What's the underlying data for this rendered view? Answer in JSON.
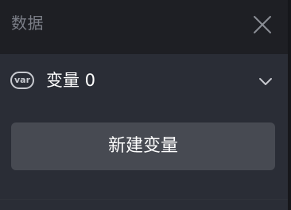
{
  "panel": {
    "title": "数据",
    "close_icon": "close-icon"
  },
  "section": {
    "badge": "var",
    "label": "变量 0",
    "chevron_icon": "chevron-down-icon"
  },
  "actions": {
    "new_variable_label": "新建变量"
  }
}
